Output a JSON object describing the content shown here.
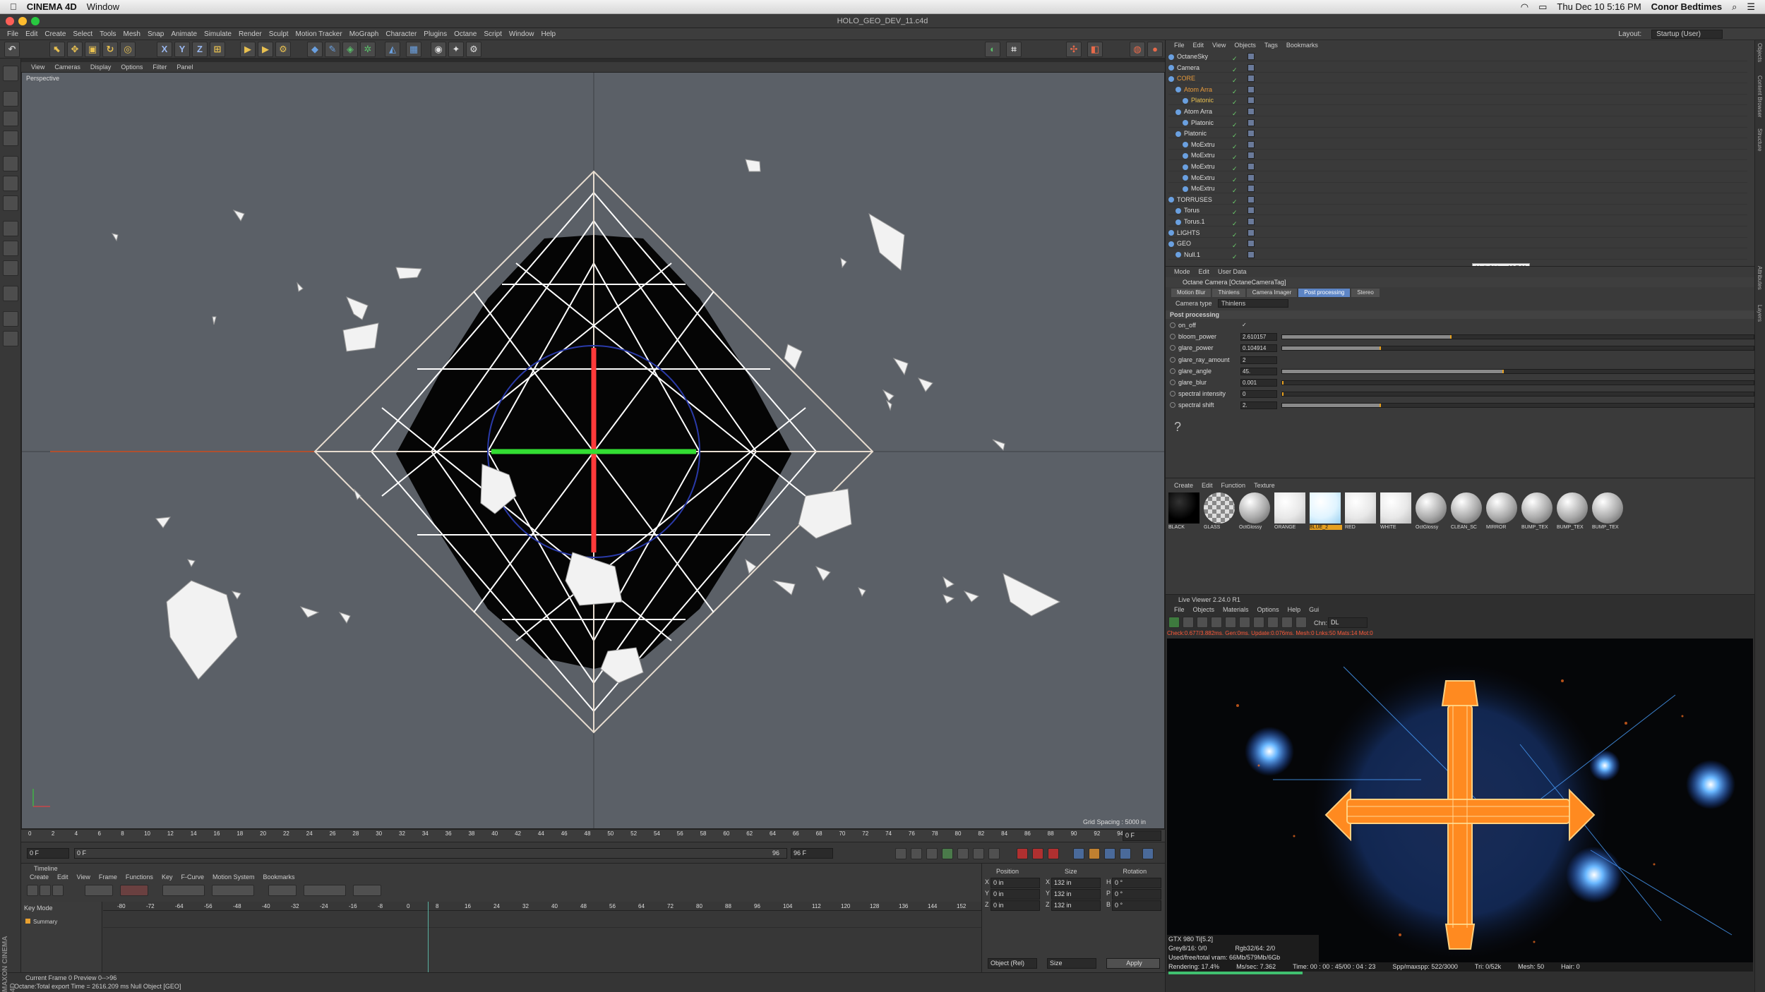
{
  "macbar": {
    "app": "CINEMA 4D",
    "menu_window": "Window",
    "datetime": "Thu Dec 10  5:16 PM",
    "user": "Conor Bedtimes"
  },
  "window_title": "HOLO_GEO_DEV_11.c4d",
  "main_menu": [
    "File",
    "Edit",
    "Create",
    "Select",
    "Tools",
    "Mesh",
    "Snap",
    "Animate",
    "Simulate",
    "Render",
    "Sculpt",
    "Motion Tracker",
    "MoGraph",
    "Character",
    "Plugins",
    "Octane",
    "Script",
    "Window",
    "Help"
  ],
  "layout": {
    "label": "Layout:",
    "value": "Startup (User)"
  },
  "toolbar_axes": [
    "X",
    "Y",
    "Z"
  ],
  "viewport": {
    "menu": [
      "View",
      "Cameras",
      "Display",
      "Options",
      "Filter",
      "Panel"
    ],
    "label": "Perspective",
    "grid_spacing": "Grid Spacing : 5000 in"
  },
  "ruler_ticks": [
    "0",
    "2",
    "4",
    "6",
    "8",
    "10",
    "12",
    "14",
    "16",
    "18",
    "20",
    "22",
    "24",
    "26",
    "28",
    "30",
    "32",
    "34",
    "36",
    "38",
    "40",
    "42",
    "44",
    "46",
    "48",
    "50",
    "52",
    "54",
    "56",
    "58",
    "60",
    "62",
    "64",
    "66",
    "68",
    "70",
    "72",
    "74",
    "76",
    "78",
    "80",
    "82",
    "84",
    "86",
    "88",
    "90",
    "92",
    "94",
    "96"
  ],
  "ruler_frame": "0 F",
  "playbar": {
    "start": "0 F",
    "end": "96 F",
    "current": "0 F",
    "preview_end": "96 F",
    "mid": "96"
  },
  "timeline": {
    "title": "Timeline",
    "menu": [
      "Create",
      "Edit",
      "View",
      "Frame",
      "Functions",
      "Key",
      "F-Curve",
      "Motion System",
      "Bookmarks"
    ],
    "mode": "Key Mode",
    "summary": "Summary",
    "ticks": [
      "-80",
      "-72",
      "-64",
      "-56",
      "-48",
      "-40",
      "-32",
      "-24",
      "-16",
      "-8",
      "0",
      "8",
      "16",
      "24",
      "32",
      "40",
      "48",
      "56",
      "64",
      "72",
      "80",
      "88",
      "96",
      "104",
      "112",
      "120",
      "128",
      "136",
      "144",
      "152"
    ]
  },
  "coords": {
    "headers": [
      "Position",
      "Size",
      "Rotation"
    ],
    "rows": [
      {
        "axis": "X",
        "pos": "0 in",
        "size_axis": "X",
        "size": "132 in",
        "rot_axis": "H",
        "rot": "0 °"
      },
      {
        "axis": "Y",
        "pos": "0 in",
        "size_axis": "Y",
        "size": "132 in",
        "rot_axis": "P",
        "rot": "0 °"
      },
      {
        "axis": "Z",
        "pos": "0 in",
        "size_axis": "Z",
        "size": "132 in",
        "rot_axis": "B",
        "rot": "0 °"
      }
    ],
    "mode_select": "Object (Rel)",
    "size_select": "Size",
    "apply": "Apply"
  },
  "status": {
    "line1": "Current Frame  0  Preview  0-->96",
    "line2": "Octane:Total export Time = 2616.209 ms     Null Object [GEO]"
  },
  "object_manager": {
    "menu": [
      "File",
      "Edit",
      "View",
      "Objects",
      "Tags",
      "Bookmarks"
    ],
    "rows": [
      {
        "name": "OctaneSky",
        "indent": 0,
        "color": "#ddd"
      },
      {
        "name": "Camera",
        "indent": 0,
        "color": "#ddd"
      },
      {
        "name": "CORE",
        "indent": 0,
        "color": "#e89a3a"
      },
      {
        "name": "Atom Arra",
        "indent": 1,
        "color": "#e89a3a"
      },
      {
        "name": "Platonic",
        "indent": 2,
        "color": "#e8c050"
      },
      {
        "name": "Atom Arra",
        "indent": 1,
        "color": "#ddd"
      },
      {
        "name": "Platonic",
        "indent": 2,
        "color": "#ddd"
      },
      {
        "name": "Platonic",
        "indent": 1,
        "color": "#ddd"
      },
      {
        "name": "MoExtru",
        "indent": 2,
        "color": "#ddd"
      },
      {
        "name": "MoExtru",
        "indent": 2,
        "color": "#ddd"
      },
      {
        "name": "MoExtru",
        "indent": 2,
        "color": "#ddd"
      },
      {
        "name": "MoExtru",
        "indent": 2,
        "color": "#ddd"
      },
      {
        "name": "MoExtru",
        "indent": 2,
        "color": "#ddd"
      },
      {
        "name": "TORRUSES",
        "indent": 0,
        "color": "#ddd"
      },
      {
        "name": "Torus",
        "indent": 1,
        "color": "#ddd"
      },
      {
        "name": "Torus.1",
        "indent": 1,
        "color": "#ddd"
      },
      {
        "name": "LIGHTS",
        "indent": 0,
        "color": "#ddd"
      },
      {
        "name": "GEO",
        "indent": 0,
        "color": "#ddd"
      },
      {
        "name": "Null.1",
        "indent": 1,
        "color": "#ddd"
      }
    ],
    "tooltip": "Null Object [GEO]"
  },
  "attribute_manager": {
    "menu": [
      "Mode",
      "Edit",
      "User Data"
    ],
    "title": "Octane Camera [OctaneCameraTag]",
    "tabs": [
      "Motion Blur",
      "Thinlens",
      "Camera Imager",
      "Post processing",
      "Stereo"
    ],
    "active_tab": "Post processing",
    "camera_type_label": "Camera type",
    "camera_type": "Thinlens",
    "section": "Post processing",
    "params": [
      {
        "name": "on_off",
        "value": "✓",
        "fill": null
      },
      {
        "name": "bloom_power",
        "value": "2.610157",
        "fill": 0.36
      },
      {
        "name": "glare_power",
        "value": "0.104914",
        "fill": 0.21
      },
      {
        "name": "glare_ray_amount",
        "value": "2",
        "fill": null
      },
      {
        "name": "glare_angle",
        "value": "45.",
        "fill": 0.47
      },
      {
        "name": "glare_blur",
        "value": "0.001",
        "fill": 0.0
      },
      {
        "name": "spectral intensity",
        "value": "0",
        "fill": 0.0
      },
      {
        "name": "spectral shift",
        "value": "2.",
        "fill": 0.21
      }
    ]
  },
  "material_manager": {
    "menu": [
      "Create",
      "Edit",
      "Function",
      "Texture"
    ],
    "materials": [
      {
        "name": "BLACK",
        "type": "black",
        "selected": false
      },
      {
        "name": "GLASS",
        "type": "glass",
        "selected": false
      },
      {
        "name": "OctGlossy",
        "type": "gloss",
        "selected": false
      },
      {
        "name": "ORANGE",
        "type": "white",
        "selected": false
      },
      {
        "name": "BLUE_2",
        "type": "blue",
        "selected": true
      },
      {
        "name": "RED",
        "type": "white",
        "selected": false
      },
      {
        "name": "WHITE",
        "type": "white",
        "selected": false
      },
      {
        "name": "OctGlossy",
        "type": "gloss",
        "selected": false
      },
      {
        "name": "CLEAN_SC",
        "type": "gloss",
        "selected": false
      },
      {
        "name": "MIRROR",
        "type": "gloss",
        "selected": false
      },
      {
        "name": "BUMP_TEX",
        "type": "gloss",
        "selected": false
      },
      {
        "name": "BUMP_TEX",
        "type": "gloss",
        "selected": false
      },
      {
        "name": "BUMP_TEX",
        "type": "gloss",
        "selected": false
      }
    ]
  },
  "live_viewer": {
    "title": "Live Viewer 2.24.0 R1",
    "menu": [
      "File",
      "Objects",
      "Materials",
      "Options",
      "Help",
      "Gui"
    ],
    "channel_label": "Chn:",
    "channel": "DL",
    "stats_line": "Check:0.677/3.882ms. Gen:0ms. Update:0.076ms. Mesh:0 Lnks:50 Mats:14 Mot:0",
    "gpu": "GTX 980 Ti[5.2]",
    "grey": "Grey8/16: 0/0",
    "rgb": "Rgb32/64: 2/0",
    "vram": "Used/free/total vram: 66Mb/579Mb/6Gb",
    "rendering": "Rendering:  17.4%",
    "mspersec": "Ms/sec:  7.362",
    "time": "Time:  00 : 00 : 45/00 : 04 : 23",
    "spp": "Spp/maxspp:  522/3000",
    "tri": "Tri:  0/52k",
    "mesh": "Mesh:  50",
    "hair": "Hair:  0"
  },
  "right_tabs": [
    "Objects",
    "Content Browser",
    "Structure",
    "Attributes",
    "Layers"
  ],
  "colors": {
    "accent": "#5d85c5",
    "axis_x": "#ff3a3a",
    "axis_y": "#33dd33",
    "orange": "#e6a020"
  }
}
